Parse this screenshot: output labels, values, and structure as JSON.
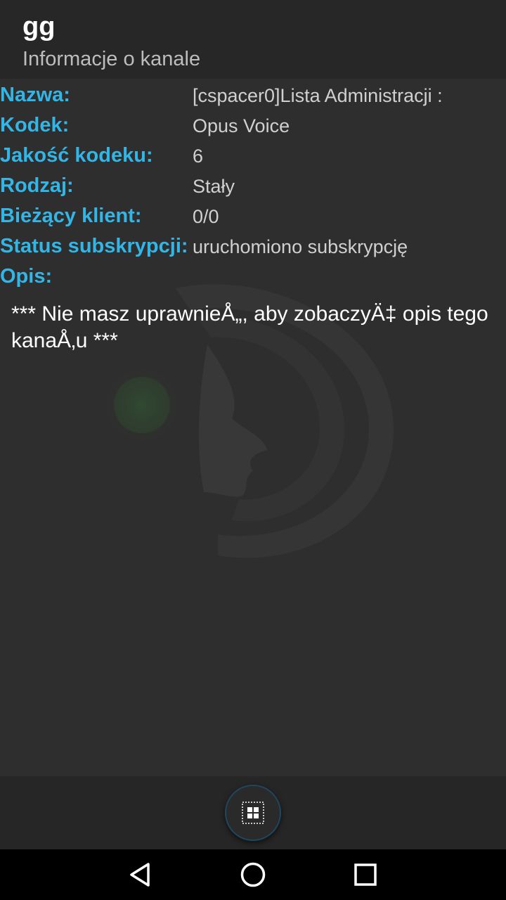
{
  "header": {
    "title": "gg",
    "subtitle": "Informacje o kanale"
  },
  "info_rows": [
    {
      "label": "Nazwa:",
      "value": "[cspacer0]Lista Administracji :"
    },
    {
      "label": "Kodek:",
      "value": "Opus Voice"
    },
    {
      "label": "Jakość kodeku:",
      "value": "6"
    },
    {
      "label": "Rodzaj:",
      "value": "Stały"
    },
    {
      "label": "Bieżący klient:",
      "value": "0/0"
    },
    {
      "label": "Status subskrypcji:",
      "value": "uruchomiono subskrypcję"
    },
    {
      "label": "Opis:",
      "value": ""
    }
  ],
  "description": "*** Nie masz uprawnieÅ„, aby zobaczyÄ‡ opis tego kanaÅ‚u ***",
  "bottom_bar": {
    "fab_icon": "grid-menu-icon"
  },
  "nav_bar": {
    "back_icon": "back-triangle-icon",
    "home_icon": "home-circle-icon",
    "recents_icon": "recents-square-icon"
  },
  "colors": {
    "label_accent": "#33b5e5",
    "background": "#2e2e2e",
    "header_background": "#272727"
  }
}
